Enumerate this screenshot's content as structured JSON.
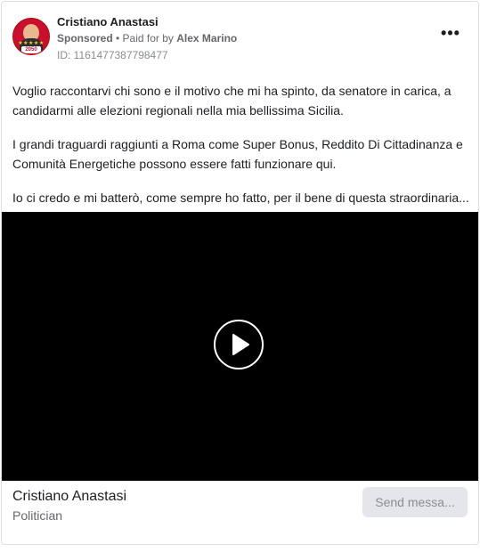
{
  "ad": {
    "page_name": "Cristiano Anastasi",
    "sponsored_label": "Sponsored",
    "paid_for_prefix": " • Paid for by ",
    "paid_for_name": "Alex Marino",
    "ad_id": "ID: 1161477387798477",
    "more_label": "•••",
    "avatar_stars": "★★★★★",
    "avatar_badge": "2050"
  },
  "body": {
    "paragraphs": [
      "Voglio raccontarvi chi sono e il motivo che mi ha spinto, da senatore in carica, a candidarmi alle elezioni regionali nella mia bellissima Sicilia.",
      "I grandi traguardi raggiunti a Roma come Super Bonus, Reddito Di Cittadinanza e Comunità Energetiche possono essere fatti funzionare qui.",
      "Io ci credo e mi batterò, come sempre ho fatto, per il bene di questa straordinaria..."
    ]
  },
  "video": {
    "play_icon": "play-icon"
  },
  "footer": {
    "page_name": "Cristiano Anastasi",
    "category": "Politician",
    "cta_label": "Send messa..."
  },
  "colors": {
    "card_border": "#dddfe2",
    "secondary_text": "#65676b",
    "button_bg": "#e4e6eb",
    "avatar_red": "#c8102e"
  }
}
